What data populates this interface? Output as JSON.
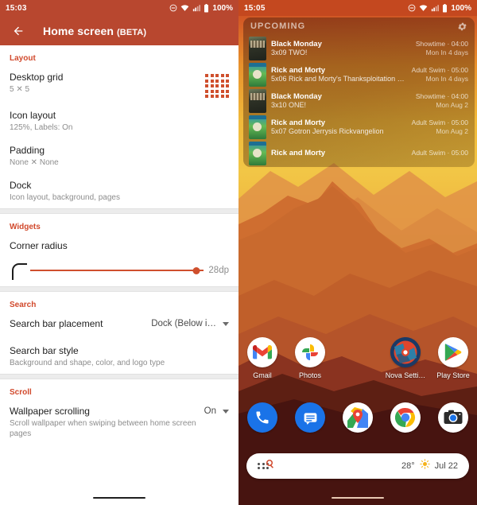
{
  "settings_screen": {
    "status_bar": {
      "time": "15:03",
      "battery": "100%",
      "icons": [
        "dnd-icon",
        "wifi-icon",
        "signal-icon",
        "battery-icon"
      ]
    },
    "app_bar": {
      "back": "back-arrow-icon",
      "title": "Home screen",
      "beta": "(BETA)"
    },
    "sections": [
      {
        "title": "Layout",
        "rows": [
          {
            "title": "Desktop grid",
            "sub": "5 ✕ 5",
            "value": "",
            "widget": "grid-5x5"
          },
          {
            "title": "Icon layout",
            "sub": "125%, Labels: On",
            "value": ""
          },
          {
            "title": "Padding",
            "sub": "None ✕ None",
            "value": ""
          },
          {
            "title": "Dock",
            "sub": "Icon layout, background, pages",
            "value": ""
          }
        ]
      },
      {
        "title": "Widgets",
        "rows": [
          {
            "title": "Corner radius",
            "sub": "",
            "value": ""
          }
        ],
        "slider": {
          "value_label": "28dp",
          "percent": 95
        }
      },
      {
        "title": "Search",
        "rows": [
          {
            "title": "Search bar placement",
            "sub": "",
            "value": "Dock (Below i…"
          },
          {
            "title": "Search bar style",
            "sub": "Background and shape, color, and logo type",
            "value": ""
          }
        ]
      },
      {
        "title": "Scroll",
        "rows": [
          {
            "title": "Wallpaper scrolling",
            "sub": "Scroll wallpaper when swiping between home screen pages",
            "value": "On"
          }
        ]
      }
    ]
  },
  "home_screen": {
    "status_bar": {
      "time": "15:05",
      "battery": "100%"
    },
    "widget": {
      "header": "UPCOMING",
      "settings_icon": "gear-icon",
      "items": [
        {
          "show": "Black Monday",
          "episode": "3x09 TWO!",
          "network": "Showtime · 04:00",
          "when": "Mon In 4 days",
          "art": "bm"
        },
        {
          "show": "Rick and Morty",
          "episode": "5x06 Rick and Morty's Thanksploitation Spec…",
          "network": "Adult Swim · 05:00",
          "when": "Mon In 4 days",
          "art": "rm"
        },
        {
          "show": "Black Monday",
          "episode": "3x10 ONE!",
          "network": "Showtime · 04:00",
          "when": "Mon Aug 2",
          "art": "bm"
        },
        {
          "show": "Rick and Morty",
          "episode": "5x07 Gotron Jerrysis Rickvangelion",
          "network": "Adult Swim · 05:00",
          "when": "Mon Aug 2",
          "art": "rm"
        },
        {
          "show": "Rick and Morty",
          "episode": "",
          "network": "Adult Swim · 05:00",
          "when": "",
          "art": "rm"
        }
      ]
    },
    "apps": [
      {
        "label": "Gmail",
        "icon": "gmail-icon"
      },
      {
        "label": "Photos",
        "icon": "google-photos-icon"
      },
      {
        "label": "",
        "icon": ""
      },
      {
        "label": "Nova Setti…",
        "icon": "nova-settings-icon"
      },
      {
        "label": "Play Store",
        "icon": "play-store-icon"
      }
    ],
    "dock": [
      {
        "label": "Phone",
        "icon": "phone-icon"
      },
      {
        "label": "Messages",
        "icon": "messages-icon"
      },
      {
        "label": "Maps",
        "icon": "maps-icon"
      },
      {
        "label": "Chrome",
        "icon": "chrome-icon"
      },
      {
        "label": "Camera",
        "icon": "camera-icon"
      }
    ],
    "search_bar": {
      "apps_icon": "app-drawer-dots-icon",
      "search_icon": "search-icon",
      "temperature": "28°",
      "weather_icon": "sun-icon",
      "date": "Jul 22"
    }
  },
  "colors": {
    "accent": "#cf4f2d",
    "appbar": "#b8472f",
    "section_header": "#d1492c"
  }
}
